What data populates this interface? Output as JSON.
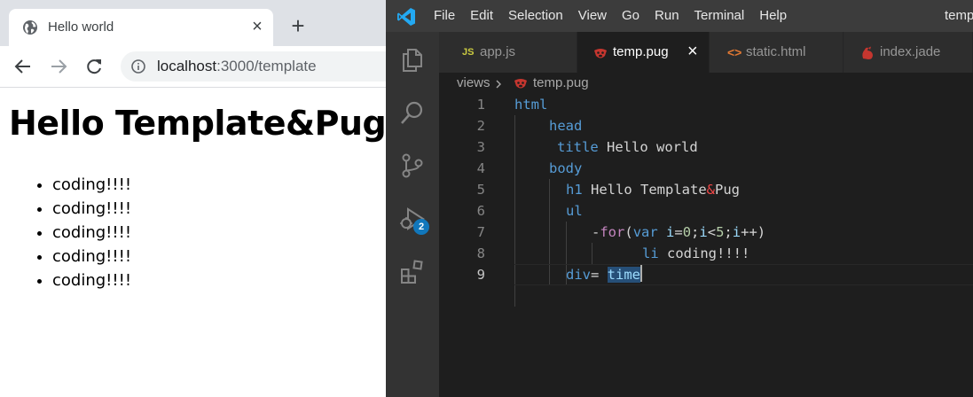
{
  "browser": {
    "tab_title": "Hello world",
    "url_host": "localhost",
    "url_path": ":3000/template",
    "page": {
      "heading": "Hello Template&Pug",
      "items": [
        "coding!!!!",
        "coding!!!!",
        "coding!!!!",
        "coding!!!!",
        "coding!!!!"
      ]
    }
  },
  "vscode": {
    "menu": [
      "File",
      "Edit",
      "Selection",
      "View",
      "Go",
      "Run",
      "Terminal",
      "Help"
    ],
    "window_title": "temp",
    "activity_badge": "2",
    "tabs": [
      {
        "label": "app.js",
        "icon": "js-file-icon",
        "badge": "JS"
      },
      {
        "label": "temp.pug",
        "icon": "pug-file-icon",
        "active": true
      },
      {
        "label": "static.html",
        "icon": "html-file-icon",
        "badge": "<>"
      },
      {
        "label": "index.jade",
        "icon": "jade-file-icon"
      }
    ],
    "breadcrumb": {
      "folder": "views",
      "file": "temp.pug"
    },
    "line_numbers": [
      "1",
      "2",
      "3",
      "4",
      "5",
      "6",
      "7",
      "8",
      "9"
    ],
    "code": {
      "l1_tag": "html",
      "l2_tag": "head",
      "l3_tag": "title",
      "l3_text": " Hello world",
      "l4_tag": "body",
      "l5_tag": "h1",
      "l5_text1": " Hello Template",
      "l5_amp": "&",
      "l5_text2": "Pug",
      "l6_tag": "ul",
      "l7_dash": "-",
      "l7_for": "for",
      "l7_open": "(",
      "l7_var": "var",
      "l7_i1": " i",
      "l7_eq": "=",
      "l7_zero": "0",
      "l7_semi1": ";",
      "l7_i2": "i",
      "l7_lt": "<",
      "l7_five": "5",
      "l7_semi2": ";",
      "l7_i3": "i",
      "l7_inc": "++)",
      "l8_tag": "li",
      "l8_text": " coding!!!!",
      "l9_tag": "div",
      "l9_eq": "= ",
      "l9_var": "time"
    },
    "colors": {
      "tag": "#569cd6",
      "keyword": "#c586c0",
      "number": "#b5cea8",
      "variable": "#9cdcfe",
      "amp": "#f44747",
      "selection": "#264f78"
    }
  }
}
